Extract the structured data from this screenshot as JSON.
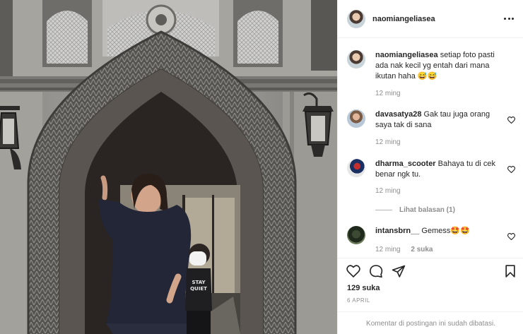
{
  "header": {
    "username": "naomiangeliasea"
  },
  "comments": [
    {
      "username": "naomiangeliasea",
      "text": "setiap foto pasti ada nak kecil yg entah dari mana ikutan haha 😅😅",
      "time": "12 ming",
      "likes": ""
    },
    {
      "username": "davasatya28",
      "text": "Gak tau juga orang saya tak di sana",
      "time": "12 ming",
      "likes": ""
    },
    {
      "username": "dharma_scooter",
      "text": "Bahaya tu di cek benar ngk tu.",
      "time": "12 ming",
      "likes": "",
      "replies_label": "Lihat balasan (1)"
    },
    {
      "username": "intansbrn__",
      "text": "Gemess🤩🤩",
      "time": "12 ming",
      "likes": "2 suka"
    }
  ],
  "footer": {
    "likes": "129 suka",
    "date": "6 APRIL",
    "comments_closed": "Komentar di postingan ini sudah dibatasi."
  },
  "photo": {
    "shirt_text": "STAY\nQUIET"
  },
  "icons": [
    "more-icon",
    "heart-icon",
    "comment-icon",
    "share-icon",
    "bookmark-icon"
  ]
}
